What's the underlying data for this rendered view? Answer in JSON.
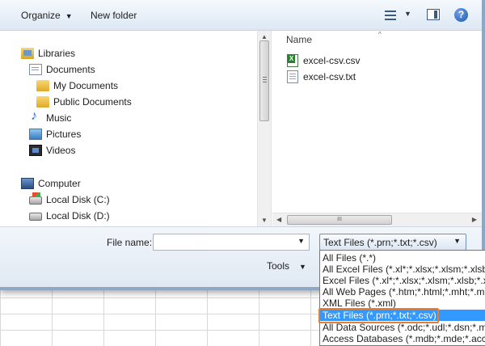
{
  "toolbar": {
    "organize_label": "Organize",
    "new_folder_label": "New folder",
    "help_label": "?"
  },
  "navigation": {
    "items": [
      {
        "label": "Libraries",
        "icon": "libraries-icon"
      },
      {
        "label": "Documents",
        "icon": "documents-icon"
      },
      {
        "label": "My Documents",
        "icon": "folder-icon"
      },
      {
        "label": "Public Documents",
        "icon": "folder-icon"
      },
      {
        "label": "Music",
        "icon": "music-icon"
      },
      {
        "label": "Pictures",
        "icon": "pictures-icon"
      },
      {
        "label": "Videos",
        "icon": "videos-icon"
      },
      {
        "label": "Computer",
        "icon": "computer-icon"
      },
      {
        "label": "Local Disk (C:)",
        "icon": "disk-icon"
      },
      {
        "label": "Local Disk (D:)",
        "icon": "disk-icon"
      }
    ]
  },
  "content": {
    "column_header": "Name",
    "files": [
      {
        "name": "excel-csv.csv",
        "icon": "excel-file-icon"
      },
      {
        "name": "excel-csv.txt",
        "icon": "text-file-icon"
      }
    ],
    "hscroll_grip": "III"
  },
  "bottom": {
    "file_name_label": "File name:",
    "file_name_value": "",
    "file_type_selected": "Text Files (*.prn;*.txt;*.csv)",
    "tools_label": "Tools"
  },
  "dropdown": {
    "options": [
      "All Files (*.*)",
      "All Excel Files (*.xl*;*.xlsx;*.xlsm;*.xlsb;*.xl",
      "Excel Files (*.xl*;*.xlsx;*.xlsm;*.xlsb;*.xlam",
      "All Web Pages (*.htm;*.html;*.mht;*.mh",
      "XML Files (*.xml)",
      "Text Files (*.prn;*.txt;*.csv)",
      "All Data Sources (*.odc;*.udl;*.dsn;*.mdb",
      "Access Databases (*.mdb;*.mde;*.accdb"
    ],
    "selected_index": 5
  },
  "colors": {
    "selection": "#3399ff",
    "highlight_border": "#e97e30",
    "toolbar_top": "#f5f9fd",
    "toolbar_bottom": "#dde8f4"
  }
}
